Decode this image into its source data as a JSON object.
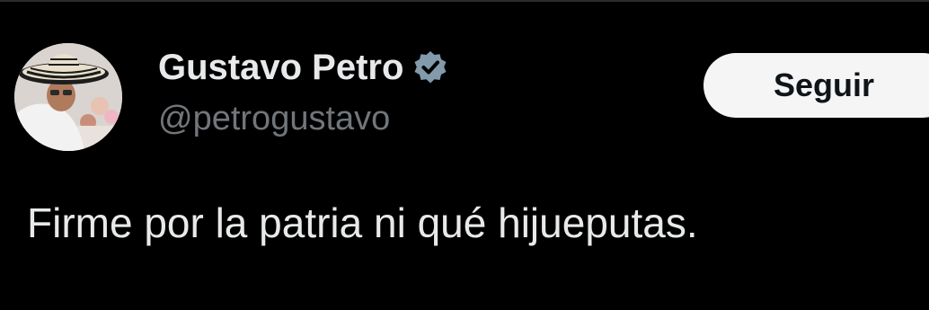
{
  "tweet": {
    "author": {
      "display_name": "Gustavo Petro",
      "handle": "@petrogustavo",
      "verified": true,
      "avatar_icon": "profile-photo"
    },
    "follow_button_label": "Seguir",
    "text": "Firme por la patria ni qué hijueputas."
  },
  "colors": {
    "background": "#000000",
    "primary_text": "#e7e9ea",
    "secondary_text": "#71767b",
    "verified_badge": "#829aab",
    "follow_button_bg": "#f5f5f5",
    "follow_button_text": "#0f1419"
  }
}
